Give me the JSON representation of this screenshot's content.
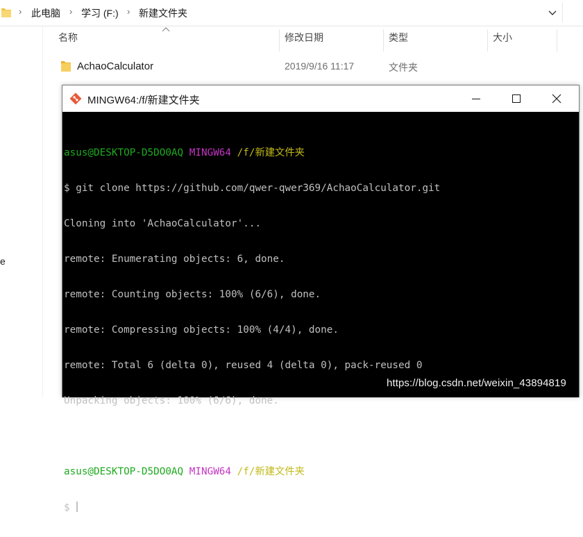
{
  "explorer": {
    "breadcrumb": [
      "此电脑",
      "学习 (F:)",
      "新建文件夹"
    ],
    "columns": {
      "name": "名称",
      "date_modified": "修改日期",
      "type": "类型",
      "size": "大小"
    },
    "nav_partial_text": "e",
    "files": [
      {
        "name": "AchaoCalculator",
        "date": "2019/9/16 11:17",
        "type": "文件夹",
        "size": ""
      }
    ]
  },
  "terminal": {
    "title": "MINGW64:/f/新建文件夹",
    "prompt_user": "asus@DESKTOP-D5DO0AQ",
    "prompt_env": "MINGW64",
    "prompt_path": "/f/新建文件夹",
    "command_line": "$ git clone https://github.com/qwer-qwer369/AchaoCalculator.git",
    "output": [
      "Cloning into 'AchaoCalculator'...",
      "remote: Enumerating objects: 6, done.",
      "remote: Counting objects: 100% (6/6), done.",
      "remote: Compressing objects: 100% (4/4), done.",
      "remote: Total 6 (delta 0), reused 4 (delta 0), pack-reused 0",
      "Unpacking objects: 100% (6/6), done."
    ],
    "prompt_char": "$"
  },
  "watermark": "https://blog.csdn.net/weixin_43894819",
  "colors": {
    "prompt_user": "#1faa1f",
    "prompt_env": "#c434c4",
    "prompt_path": "#c2b91a",
    "terminal_bg": "#000000",
    "folder": "#f3c53f"
  },
  "icons": [
    "folder-icon",
    "chevron-right-icon",
    "chevron-down-icon",
    "sort-ascending-icon",
    "git-icon",
    "minimize-icon",
    "maximize-icon",
    "close-icon"
  ]
}
